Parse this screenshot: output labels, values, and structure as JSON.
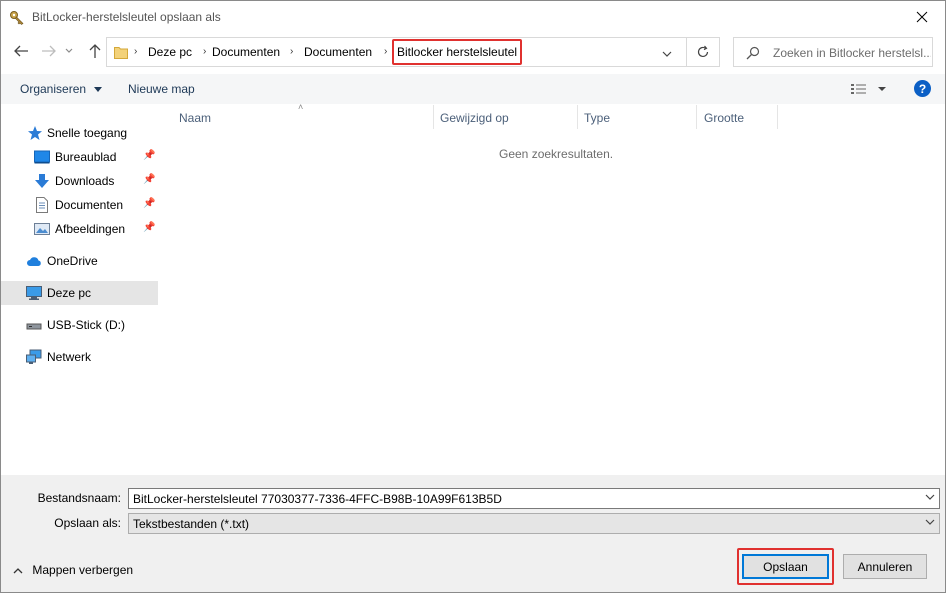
{
  "window": {
    "title": "BitLocker-herstelsleutel opslaan als"
  },
  "nav": {
    "breadcrumb": [
      "Deze pc",
      "Documenten",
      "Documenten",
      "Bitlocker herstelsleutel"
    ],
    "search_placeholder": "Zoeken in Bitlocker herstelsl..."
  },
  "toolbar": {
    "organize_label": "Organiseren",
    "new_folder_label": "Nieuwe map",
    "help_label": "?"
  },
  "sidebar": {
    "items": [
      {
        "label": "Snelle toegang",
        "icon": "star-icon"
      },
      {
        "label": "Bureaublad",
        "icon": "desktop-icon",
        "pinned": true
      },
      {
        "label": "Downloads",
        "icon": "download-arrow-icon",
        "pinned": true
      },
      {
        "label": "Documenten",
        "icon": "document-icon",
        "pinned": true
      },
      {
        "label": "Afbeeldingen",
        "icon": "pictures-icon",
        "pinned": true
      },
      {
        "label": "OneDrive",
        "icon": "cloud-icon"
      },
      {
        "label": "Deze pc",
        "icon": "computer-icon",
        "selected": true
      },
      {
        "label": "USB-Stick (D:)",
        "icon": "usb-drive-icon"
      },
      {
        "label": "Netwerk",
        "icon": "network-icon"
      }
    ]
  },
  "list": {
    "columns": [
      "Naam",
      "Gewijzigd op",
      "Type",
      "Grootte"
    ],
    "empty_message": "Geen zoekresultaten."
  },
  "form": {
    "filename_label": "Bestandsnaam:",
    "filename_value": "BitLocker-herstelsleutel 77030377-7336-4FFC-B98B-10A99F613B5D",
    "save_as_label": "Opslaan als:",
    "save_as_value": "Tekstbestanden (*.txt)",
    "hide_folders_label": "Mappen verbergen",
    "save_button": "Opslaan",
    "cancel_button": "Annuleren"
  },
  "colors": {
    "highlight": "#e0312f",
    "accent": "#0078d7",
    "folder": "#f3d27a"
  }
}
